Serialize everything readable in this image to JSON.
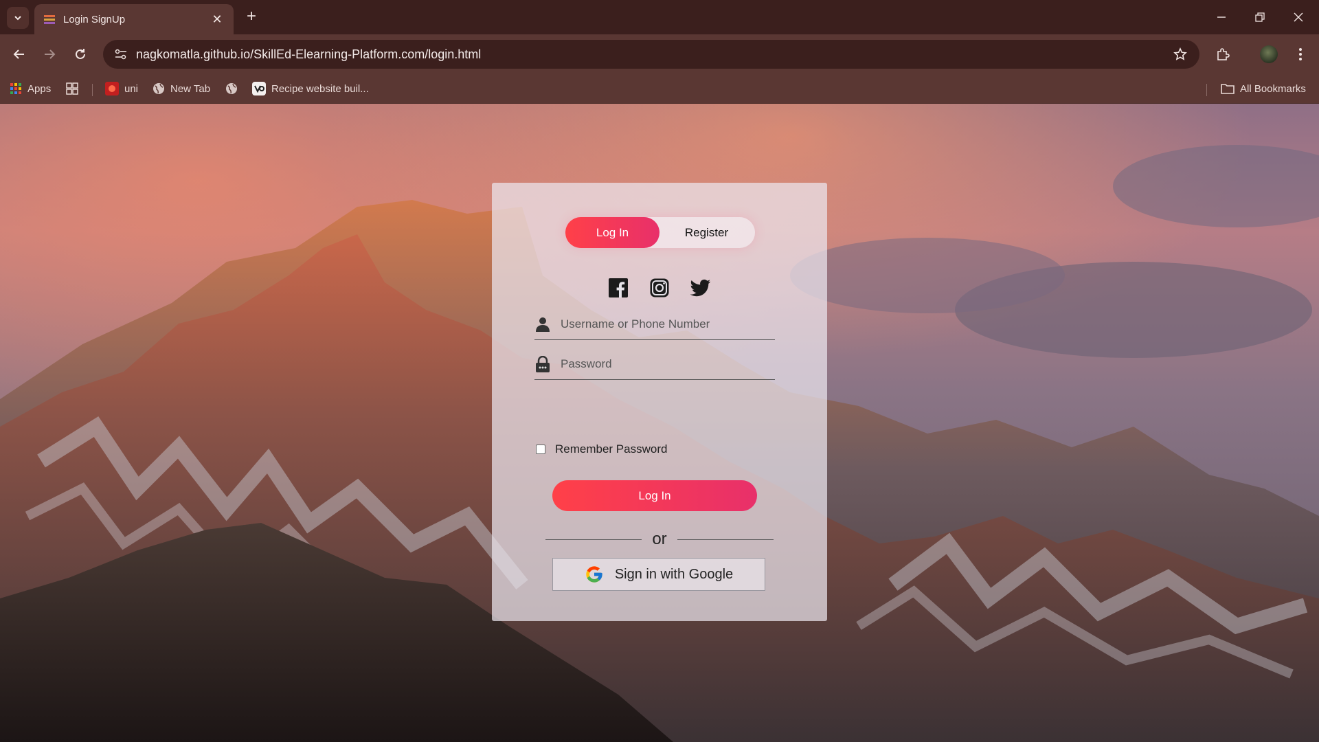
{
  "browser": {
    "tab_title": "Login SignUp",
    "url": "nagkomatla.github.io/SkillEd-Elearning-Platform.com/login.html",
    "bookmarks": [
      {
        "label": "Apps",
        "icon": "apps-grid-icon"
      },
      {
        "label": "",
        "icon": "tab-groups-icon"
      },
      {
        "label": "uni",
        "icon": "uni-favicon"
      },
      {
        "label": "New Tab",
        "icon": "globe-icon"
      },
      {
        "label": "",
        "icon": "globe-icon"
      },
      {
        "label": "Recipe website buil...",
        "icon": "recipe-favicon"
      }
    ],
    "all_bookmarks": "All Bookmarks"
  },
  "auth": {
    "toggle_login": "Log In",
    "toggle_register": "Register",
    "socials": [
      "facebook-icon",
      "instagram-icon",
      "twitter-icon"
    ],
    "username_placeholder": "Username or Phone Number",
    "password_placeholder": "Password",
    "remember_label": "Remember Password",
    "submit_label": "Log In",
    "or_text": "or",
    "google_label": "Sign in with Google"
  },
  "colors": {
    "accent_start": "#ff4048",
    "accent_end": "#e8306a",
    "chrome_dark": "#3b1f1d",
    "chrome_mid": "#5a3733"
  }
}
